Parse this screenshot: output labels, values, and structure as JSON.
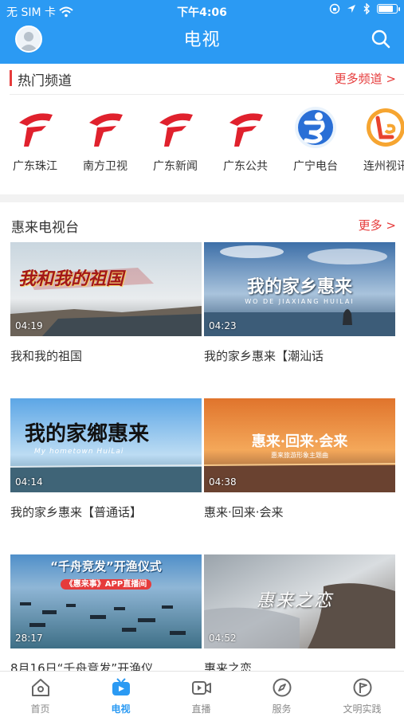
{
  "status_bar": {
    "carrier": "无 SIM 卡",
    "time": "下午4:06"
  },
  "header": {
    "title": "电视"
  },
  "hot_channels": {
    "title": "热门频道",
    "more": "更多频道 >",
    "items": [
      {
        "name": "广东珠江",
        "icon": "gdtv-logo"
      },
      {
        "name": "南方卫视",
        "icon": "gdtv-logo"
      },
      {
        "name": "广东新闻",
        "icon": "gdtv-logo"
      },
      {
        "name": "广东公共",
        "icon": "gdtv-logo"
      },
      {
        "name": "广宁电台",
        "icon": "guangning-logo"
      },
      {
        "name": "连州视讯",
        "icon": "lianzhou-logo"
      }
    ]
  },
  "huilai": {
    "title": "惠来电视台",
    "more": "更多 >",
    "videos": [
      {
        "title": "我和我的祖国",
        "duration": "04:19",
        "overlay": "我和我的祖国"
      },
      {
        "title": "我的家乡惠来【潮汕话",
        "duration": "04:23",
        "overlay": "我的家乡惠来",
        "overlay_sub": "WO DE JIAXIANG HUILAI"
      },
      {
        "title": "我的家乡惠来【普通话】",
        "duration": "04:14",
        "overlay": "我的家鄉惠来",
        "overlay_sub": "My hometown HuiLai"
      },
      {
        "title": "惠来·回来·会来",
        "duration": "04:38",
        "overlay": "惠来·回来·会来",
        "overlay_sub": "惠来旅游形象主题曲"
      },
      {
        "title": "8月16日“千舟竞发”开渔仪",
        "duration": "28:17",
        "overlay": "“千舟竞发”开渔仪式",
        "overlay_sub": "《惠来事》APP直播间"
      },
      {
        "title": "惠来之恋",
        "duration": "04:52",
        "overlay": "惠来之恋"
      }
    ]
  },
  "tabbar": {
    "items": [
      {
        "label": "首页",
        "icon": "home-icon",
        "active": false
      },
      {
        "label": "电视",
        "icon": "tv-icon",
        "active": true
      },
      {
        "label": "直播",
        "icon": "live-camera-icon",
        "active": false
      },
      {
        "label": "服务",
        "icon": "compass-icon",
        "active": false
      },
      {
        "label": "文明实践",
        "icon": "flag-icon",
        "active": false
      }
    ]
  },
  "colors": {
    "primary": "#2b9af3",
    "accent": "#e63b3b"
  }
}
